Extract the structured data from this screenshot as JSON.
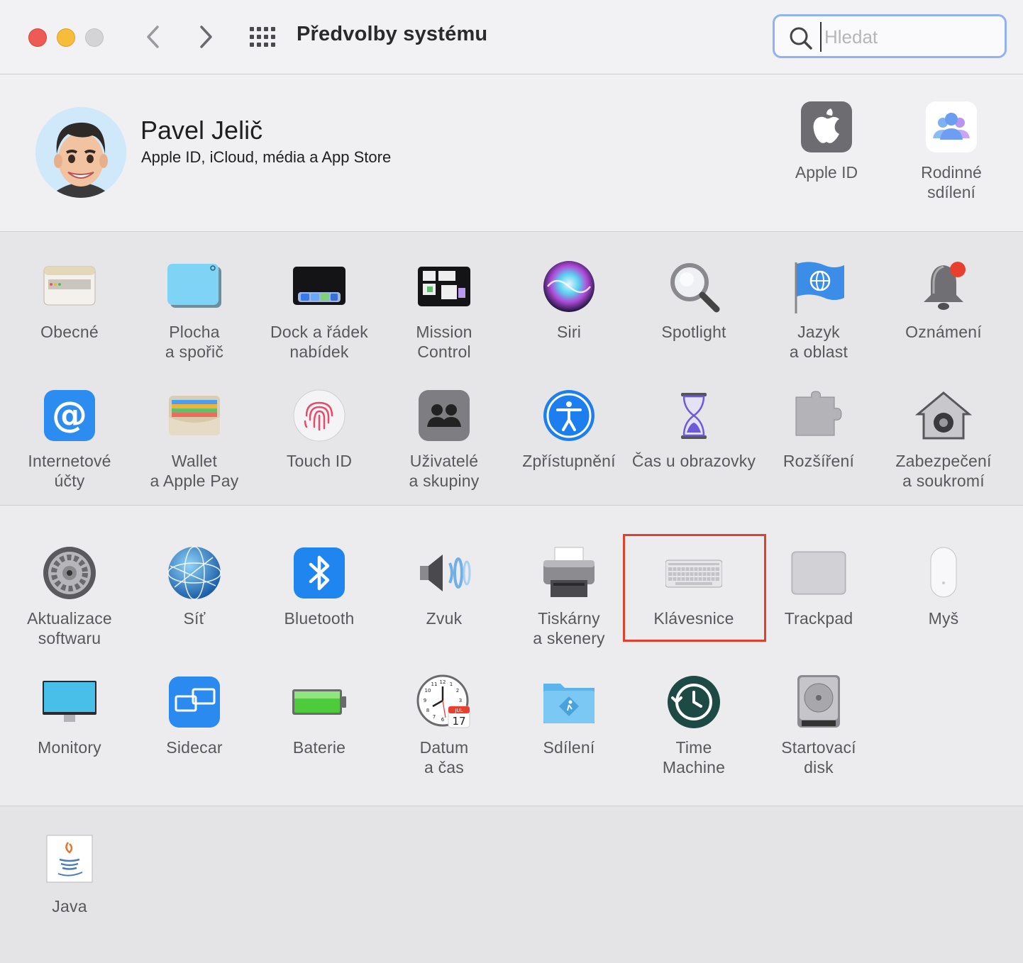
{
  "window": {
    "title": "Předvolby systému",
    "search": {
      "placeholder": "Hledat",
      "value": ""
    }
  },
  "account": {
    "name": "Pavel Jelič",
    "subtitle": "Apple ID, iCloud, média a App Store",
    "items": [
      {
        "label": "Apple ID",
        "icon": "apple-logo-icon"
      },
      {
        "label": "Rodinné\nsdílení",
        "icon": "family-sharing-icon"
      }
    ]
  },
  "section1": [
    {
      "label": "Obecné",
      "icon": "general-icon"
    },
    {
      "label": "Plocha\na spořič",
      "icon": "desktop-screensaver-icon"
    },
    {
      "label": "Dock a řádek\nnabídek",
      "icon": "dock-icon"
    },
    {
      "label": "Mission\nControl",
      "icon": "mission-control-icon"
    },
    {
      "label": "Siri",
      "icon": "siri-icon"
    },
    {
      "label": "Spotlight",
      "icon": "spotlight-icon"
    },
    {
      "label": "Jazyk\na oblast",
      "icon": "language-region-icon"
    },
    {
      "label": "Oznámení",
      "icon": "notifications-icon"
    },
    {
      "label": "Internetové\núčty",
      "icon": "internet-accounts-icon"
    },
    {
      "label": "Wallet\na Apple Pay",
      "icon": "wallet-icon"
    },
    {
      "label": "Touch ID",
      "icon": "touch-id-icon"
    },
    {
      "label": "Uživatelé\na skupiny",
      "icon": "users-groups-icon"
    },
    {
      "label": "Zpřístupnění",
      "icon": "accessibility-icon"
    },
    {
      "label": "Čas u obrazovky",
      "icon": "screen-time-icon"
    },
    {
      "label": "Rozšíření",
      "icon": "extensions-icon"
    },
    {
      "label": "Zabezpečení\na soukromí",
      "icon": "security-privacy-icon"
    }
  ],
  "section2": [
    {
      "label": "Aktualizace\nsoftwaru",
      "icon": "software-update-icon"
    },
    {
      "label": "Síť",
      "icon": "network-icon"
    },
    {
      "label": "Bluetooth",
      "icon": "bluetooth-icon"
    },
    {
      "label": "Zvuk",
      "icon": "sound-icon"
    },
    {
      "label": "Tiskárny\na skenery",
      "icon": "printers-scanners-icon"
    },
    {
      "label": "Klávesnice",
      "icon": "keyboard-icon"
    },
    {
      "label": "Trackpad",
      "icon": "trackpad-icon"
    },
    {
      "label": "Myš",
      "icon": "mouse-icon"
    },
    {
      "label": "Monitory",
      "icon": "displays-icon"
    },
    {
      "label": "Sidecar",
      "icon": "sidecar-icon"
    },
    {
      "label": "Baterie",
      "icon": "battery-icon"
    },
    {
      "label": "Datum\na čas",
      "icon": "date-time-icon"
    },
    {
      "label": "Sdílení",
      "icon": "sharing-icon"
    },
    {
      "label": "Time\nMachine",
      "icon": "time-machine-icon"
    },
    {
      "label": "Startovací\ndisk",
      "icon": "startup-disk-icon"
    }
  ],
  "section3": [
    {
      "label": "Java",
      "icon": "java-icon"
    }
  ],
  "icon_text": {
    "clock_month": "JUL",
    "clock_day": "17",
    "clock_numbers": [
      "12",
      "1",
      "2",
      "3",
      "4",
      "5",
      "6",
      "7",
      "8",
      "9",
      "10",
      "11"
    ]
  },
  "colors": {
    "highlight": "#e0412f",
    "search_focus": "#8fb3f4",
    "close": "#ee5b55",
    "minimize": "#f5bd3a"
  }
}
